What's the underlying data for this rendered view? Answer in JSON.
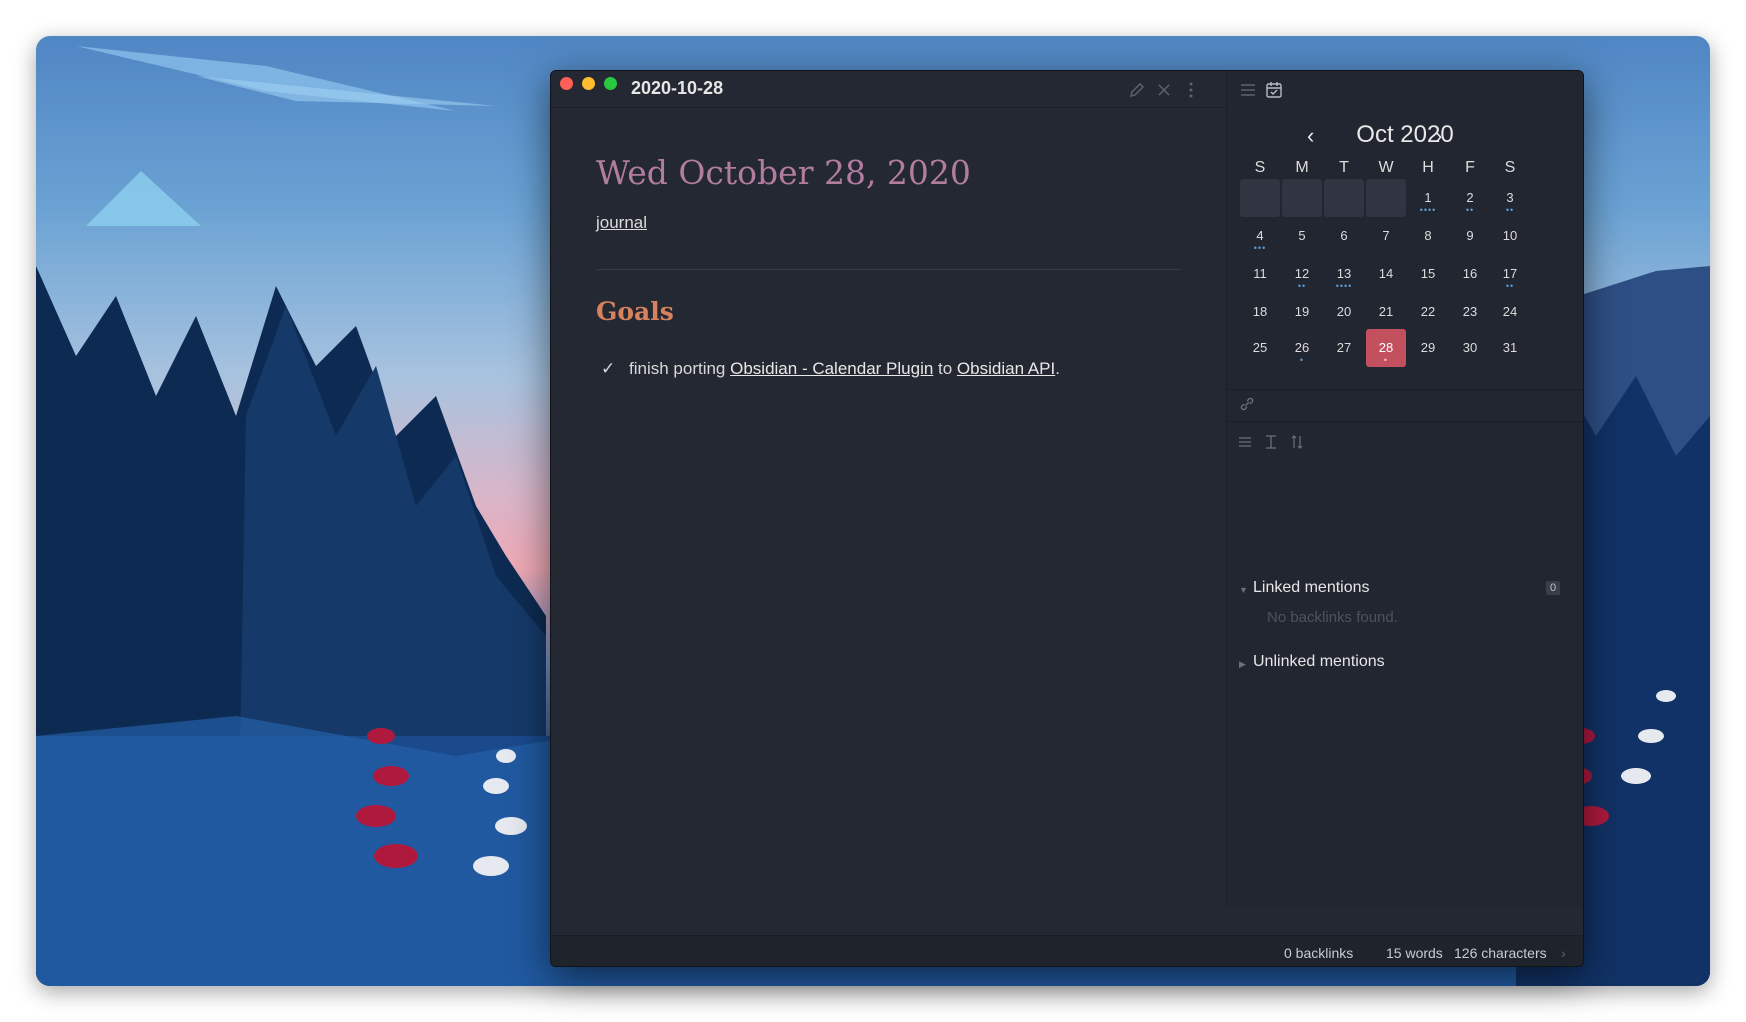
{
  "window": {
    "title": "2020-10-28"
  },
  "editor": {
    "heading": "Wed October 28, 2020",
    "tag": "journal",
    "section_title": "Goals",
    "task": {
      "text_before": "finish porting ",
      "link1": "Obsidian - Calendar Plugin",
      "text_middle": " to ",
      "link2": "Obsidian API",
      "text_after": "."
    }
  },
  "calendar": {
    "month_label": "Oct 2020",
    "prev_icon": "chevron-left-icon",
    "next_icon": "chevron-right-icon",
    "weekdays": [
      "S",
      "M",
      "T",
      "W",
      "H",
      "F",
      "S"
    ],
    "today": 28,
    "days": [
      {
        "n": "1",
        "dots": 4
      },
      {
        "n": "2",
        "dots": 2
      },
      {
        "n": "3",
        "dots": 2
      },
      {
        "n": "4",
        "dots": 3
      },
      {
        "n": "5",
        "dots": 0
      },
      {
        "n": "6",
        "dots": 0
      },
      {
        "n": "7",
        "dots": 0
      },
      {
        "n": "8",
        "dots": 0
      },
      {
        "n": "9",
        "dots": 0
      },
      {
        "n": "10",
        "dots": 0
      },
      {
        "n": "11",
        "dots": 0
      },
      {
        "n": "12",
        "dots": 2
      },
      {
        "n": "13",
        "dots": 4
      },
      {
        "n": "14",
        "dots": 0
      },
      {
        "n": "15",
        "dots": 0
      },
      {
        "n": "16",
        "dots": 0
      },
      {
        "n": "17",
        "dots": 2
      },
      {
        "n": "18",
        "dots": 0
      },
      {
        "n": "19",
        "dots": 0
      },
      {
        "n": "20",
        "dots": 0
      },
      {
        "n": "21",
        "dots": 0
      },
      {
        "n": "22",
        "dots": 0
      },
      {
        "n": "23",
        "dots": 0
      },
      {
        "n": "24",
        "dots": 0
      },
      {
        "n": "25",
        "dots": 0
      },
      {
        "n": "26",
        "dots": 1
      },
      {
        "n": "27",
        "dots": 0
      },
      {
        "n": "28",
        "dots": 1
      },
      {
        "n": "29",
        "dots": 0
      },
      {
        "n": "30",
        "dots": 0
      },
      {
        "n": "31",
        "dots": 0
      }
    ],
    "accent_color": "#c2505f",
    "dot_color": "#5c9ed9"
  },
  "backlinks": {
    "linked_title": "Linked mentions",
    "linked_count": "0",
    "empty_message": "No backlinks found.",
    "unlinked_title": "Unlinked mentions"
  },
  "status": {
    "backlinks": "0 backlinks",
    "words": "15 words",
    "characters": "126 characters"
  }
}
